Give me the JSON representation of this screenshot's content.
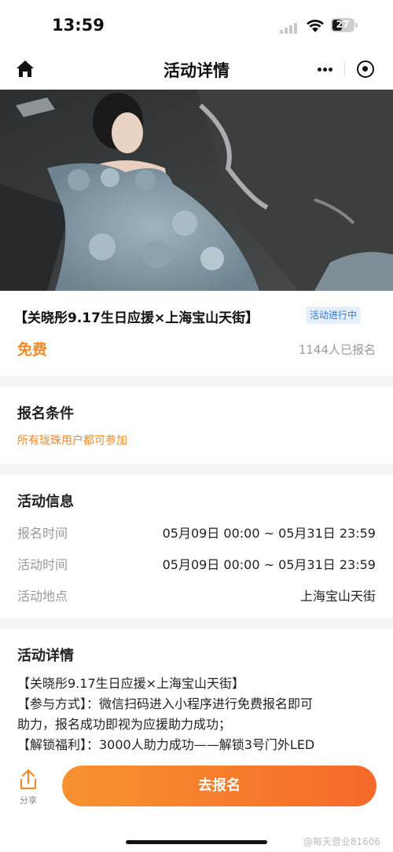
{
  "status_bar": {
    "time": "13:59",
    "battery": "27"
  },
  "nav": {
    "title": "活动详情"
  },
  "event": {
    "title": "【关晓彤9.17生日应援×上海宝山天街】",
    "status": "活动进行中",
    "price": "免费",
    "signup_count": "1144人已报名"
  },
  "conditions": {
    "title": "报名条件",
    "text": "所有珑珠用户都可参加"
  },
  "info": {
    "title": "活动信息",
    "rows": [
      {
        "label": "报名时间",
        "value": "05月09日 00:00 ~ 05月31日 23:59"
      },
      {
        "label": "活动时间",
        "value": "05月09日 00:00 ~ 05月31日 23:59"
      },
      {
        "label": "活动地点",
        "value": "上海宝山天街"
      }
    ]
  },
  "details": {
    "title": "活动详情",
    "lines": [
      "【关晓彤9.17生日应援×上海宝山天街】",
      "【参与方式】：微信扫码进入小程序进行免费报名即可",
      "助力，报名成功即视为应援助力成功；",
      "【解锁福利】：3000人助力成功——解锁3号门外LED"
    ]
  },
  "bottom": {
    "share_label": "分享",
    "cta_label": "去报名",
    "watermark": "@每天营业81606"
  },
  "colors": {
    "accent": "#f08a2c",
    "badge_blue": "#2d7be5"
  }
}
